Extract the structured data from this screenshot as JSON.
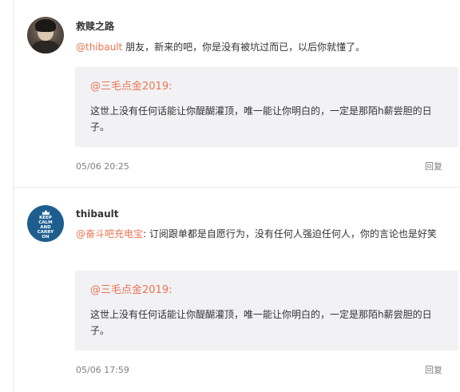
{
  "comments": [
    {
      "username": "救赎之路",
      "mention": "@thibault",
      "separator": " ",
      "text": "朋友，新来的吧，你是没有被坑过而已，以后你就懂了。",
      "quote": {
        "author": "@三毛点金2019:",
        "text": "这世上没有任何话能让你醍醐灌顶，唯一能让你明白的，一定是那陌h薪尝胆的日子。"
      },
      "timestamp": "05/06 20:25",
      "reply_label": "回复"
    },
    {
      "username": "thibault",
      "avatar_text": [
        "KEEP",
        "CALM",
        "AND",
        "CARRY",
        "ON"
      ],
      "mention": "@奋斗吧充电宝",
      "separator": ": ",
      "text": "订阅跟单都是自愿行为，没有任何人强迫任何人，你的言论也是好笑",
      "quote": {
        "author": "@三毛点金2019:",
        "text": "这世上没有任何话能让你醍醐灌顶，唯一能让你明白的，一定是那陌h薪尝胆的日子。"
      },
      "timestamp": "05/06 17:59",
      "reply_label": "回复"
    }
  ],
  "colors": {
    "mention": "#eb7350",
    "quote_background": "#f2f2f5",
    "meta_text": "#808080",
    "avatar_blue": "#1e5e8f"
  }
}
